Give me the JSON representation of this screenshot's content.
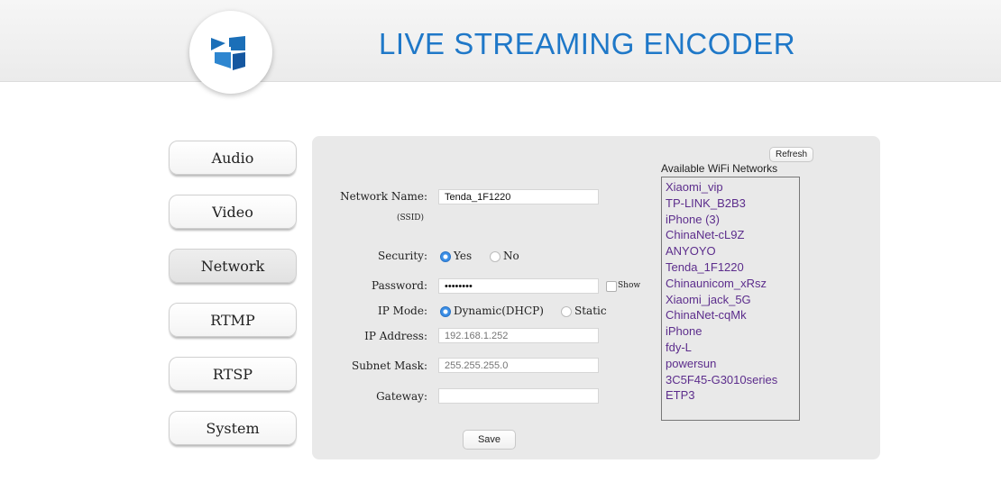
{
  "header": {
    "title": "LIVE STREAMING ENCODER"
  },
  "nav": [
    {
      "label": "Audio"
    },
    {
      "label": "Video"
    },
    {
      "label": "Network"
    },
    {
      "label": "RTMP"
    },
    {
      "label": "RTSP"
    },
    {
      "label": "System"
    }
  ],
  "active_nav": "Network",
  "form": {
    "network_name_label": "Network Name:",
    "ssid_label": "(SSID)",
    "network_name_value": "Tenda_1F1220",
    "security_label": "Security:",
    "security_yes": "Yes",
    "security_no": "No",
    "security_selected": "Yes",
    "password_label": "Password:",
    "password_value": "12345678",
    "show_label": "Show",
    "ip_mode_label": "IP Mode:",
    "ip_mode_dhcp": "Dynamic(DHCP)",
    "ip_mode_static": "Static",
    "ip_mode_selected": "Dynamic(DHCP)",
    "ip_address_label": "IP Address:",
    "ip_address_placeholder": "192.168.1.252",
    "subnet_mask_label": "Subnet Mask:",
    "subnet_mask_placeholder": "255.255.255.0",
    "gateway_label": "Gateway:",
    "gateway_value": "",
    "save_label": "Save"
  },
  "wifi": {
    "refresh_label": "Refresh",
    "title": "Available WiFi Networks",
    "networks": [
      "Xiaomi_vip",
      "TP-LINK_B2B3",
      "iPhone (3)",
      "ChinaNet-cL9Z",
      "ANYOYO",
      "Tenda_1F1220",
      "Chinaunicom_xRsz",
      "Xiaomi_jack_5G",
      "ChinaNet-cqMk",
      "iPhone",
      "fdy-L",
      "powersun",
      "3C5F45-G3010series",
      "ETP3"
    ]
  },
  "colors": {
    "title_blue": "#1f78c8",
    "wifi_text": "#5c2d8c",
    "panel_bg": "#e9e9e9"
  },
  "icons": {
    "logo": "encoder-logo-icon"
  }
}
